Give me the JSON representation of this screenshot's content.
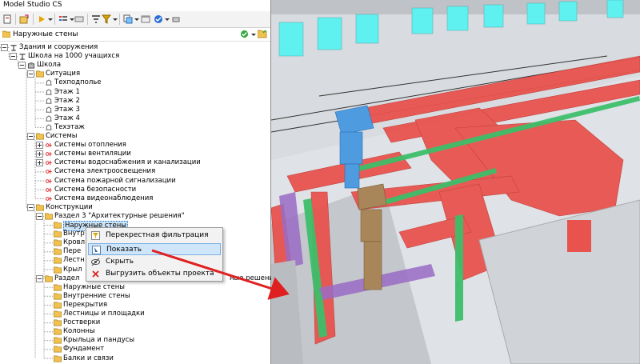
{
  "window": {
    "title": "Model Studio CS"
  },
  "filter": {
    "value": "Наружные стены"
  },
  "tree": {
    "items": [
      {
        "label": "Здания и сооружения"
      },
      {
        "label": "Школа на 1000 учащихся"
      },
      {
        "label": "Школа"
      },
      {
        "label": "Ситуация"
      },
      {
        "label": "Техподполье"
      },
      {
        "label": "Этаж 1"
      },
      {
        "label": "Этаж 2"
      },
      {
        "label": "Этаж 3"
      },
      {
        "label": "Этаж 4"
      },
      {
        "label": "Техэтаж"
      },
      {
        "label": "Системы"
      },
      {
        "label": "Системы отопления"
      },
      {
        "label": "Системы вентиляции"
      },
      {
        "label": "Системы водоснабжения и канализации"
      },
      {
        "label": "Система электроосвещения"
      },
      {
        "label": "Система пожарной сигнализации"
      },
      {
        "label": "Система безопасности"
      },
      {
        "label": "Система видеонаблюдения"
      },
      {
        "label": "Конструкции"
      },
      {
        "label": "Раздел 3 \"Архитектурные решения\""
      },
      {
        "label": "Наружные стены"
      },
      {
        "label": "Внутр"
      },
      {
        "label": "Кровл"
      },
      {
        "label": "Пере"
      },
      {
        "label": "Лестн"
      },
      {
        "label": "Крыл"
      },
      {
        "label": "Раздел"
      },
      {
        "label": "Наружные стены"
      },
      {
        "label": "Внутренние стены"
      },
      {
        "label": "Перекрытия"
      },
      {
        "label": "Лестницы и площадки"
      },
      {
        "label": "Ростверки"
      },
      {
        "label": "Колонны"
      },
      {
        "label": "Крыльца и пандусы"
      },
      {
        "label": "Фундамент"
      },
      {
        "label": "Балки и связи"
      }
    ],
    "partial_label_tail": "ные решения\""
  },
  "context_menu": {
    "items": [
      {
        "label": "Перекрестная фильтрация"
      },
      {
        "label": "Показать"
      },
      {
        "label": "Скрыть"
      },
      {
        "label": "Выгрузить объекты проекта"
      }
    ]
  },
  "colors": {
    "selection": "#cce4f7",
    "menu_highlight": "#cfe5fa",
    "arrow": "#e02020",
    "duct_red": "#e8534e",
    "duct_blue": "#4f9be0",
    "duct_tan": "#a8865a",
    "pipe_green": "#3dbf6a",
    "pipe_purple": "#9a6bc4",
    "window_cyan": "#5ff0f0"
  }
}
